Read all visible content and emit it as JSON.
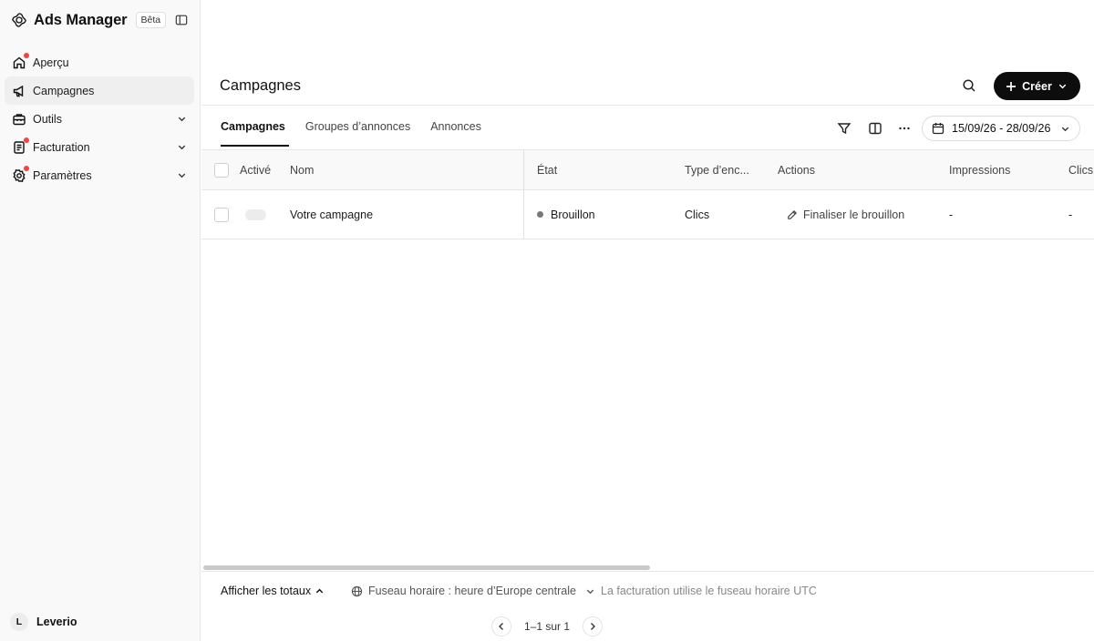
{
  "app": {
    "title": "Ads Manager",
    "badge": "Bêta"
  },
  "sidebar": {
    "items": [
      {
        "label": "Aperçu",
        "notification": true
      },
      {
        "label": "Campagnes",
        "active": true
      },
      {
        "label": "Outils",
        "expandable": true
      },
      {
        "label": "Facturation",
        "expandable": true,
        "notification": true
      },
      {
        "label": "Paramètres",
        "expandable": true,
        "notification": true
      }
    ],
    "org": {
      "initial": "L",
      "name": "Leverio"
    }
  },
  "header": {
    "title": "Campagnes",
    "create_label": "Créer"
  },
  "tabs": [
    {
      "label": "Campagnes",
      "active": true
    },
    {
      "label": "Groupes d’annonces"
    },
    {
      "label": "Annonces"
    }
  ],
  "date_range": "15/09/26 - 28/09/26",
  "table": {
    "columns": [
      "Activé",
      "Nom",
      "État",
      "Type d’enc...",
      "Actions",
      "Impressions",
      "Clics"
    ],
    "rows": [
      {
        "name": "Votre campagne",
        "status": "Brouillon",
        "type": "Clics",
        "action": "Finaliser le brouillon",
        "impressions": "-",
        "clicks": "-"
      }
    ]
  },
  "footer": {
    "totals_label": "Afficher les totaux",
    "timezone_label": "Fuseau horaire : heure d’Europe centrale",
    "billing_note": "La facturation utilise le fuseau horaire UTC",
    "pagination": "1–1 sur 1"
  },
  "colors": {
    "accent": "#0d0d0d",
    "notification": "#ef4444"
  }
}
